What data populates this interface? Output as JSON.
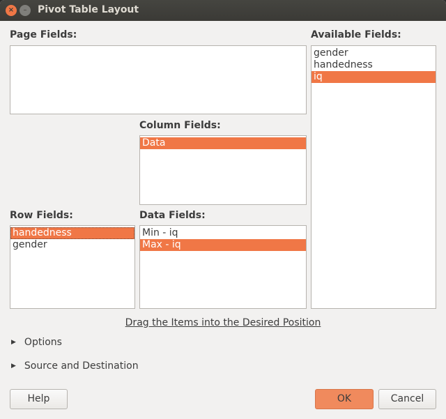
{
  "window": {
    "title": "Pivot Table Layout",
    "close_icon": "×",
    "minimize_icon": "–"
  },
  "page_fields": {
    "label": "Page Fields:",
    "items": []
  },
  "available_fields": {
    "label": "Available Fields:",
    "items": [
      "gender",
      "handedness",
      "iq"
    ],
    "selected": "iq"
  },
  "column_fields": {
    "label": "Column Fields:",
    "items": [
      "Data"
    ],
    "selected": "Data"
  },
  "row_fields": {
    "label": "Row Fields:",
    "items": [
      "handedness",
      "gender"
    ],
    "selected": "handedness"
  },
  "data_fields": {
    "label": "Data Fields:",
    "items": [
      "Min - iq",
      "Max - iq"
    ],
    "selected": "Max - iq"
  },
  "hint": "Drag the Items into the Desired Position",
  "expanders": {
    "options": "Options",
    "source_destination": "Source and Destination",
    "arrow_icon": "▶"
  },
  "buttons": {
    "help": "Help",
    "ok": "OK",
    "cancel": "Cancel"
  }
}
